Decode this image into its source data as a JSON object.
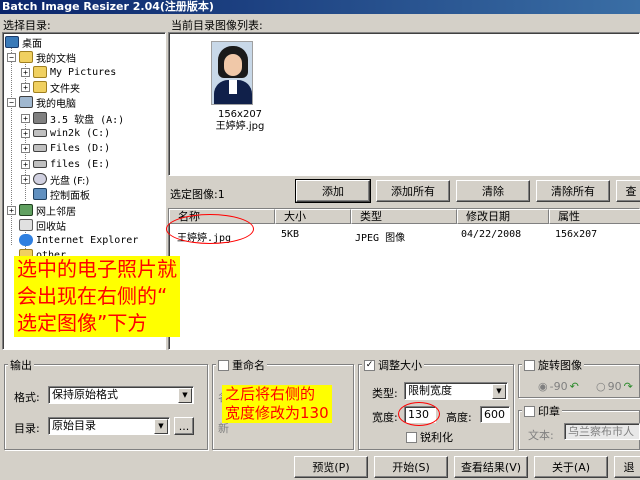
{
  "window": {
    "title": "Batch Image Resizer 2.04(注册版本)"
  },
  "tree": {
    "label": "选择目录:",
    "items": [
      {
        "label": "桌面"
      },
      {
        "label": "我的文档"
      },
      {
        "label": "My Pictures"
      },
      {
        "label": "文件夹"
      },
      {
        "label": "我的电脑"
      },
      {
        "label": "3.5 软盘 (A:)"
      },
      {
        "label": "win2k (C:)"
      },
      {
        "label": "Files (D:)"
      },
      {
        "label": "files (E:)"
      },
      {
        "label": "光盘 (F:)"
      },
      {
        "label": "控制面板"
      },
      {
        "label": "网上邻居"
      },
      {
        "label": "回收站"
      },
      {
        "label": "Internet Explorer"
      },
      {
        "label": "other"
      }
    ]
  },
  "preview": {
    "label": "当前目录图像列表:",
    "thumb_size": "156x207",
    "thumb_name": "王婷婷.jpg"
  },
  "selection": {
    "label": "选定图像:1",
    "buttons": {
      "add": "添加",
      "add_all": "添加所有",
      "clear": "清除",
      "clear_all": "清除所有",
      "view": "查"
    }
  },
  "list": {
    "columns": [
      "名称",
      "大小",
      "类型",
      "修改日期",
      "属性"
    ],
    "rows": [
      {
        "name": "王婷婷.jpg",
        "size": "5KB",
        "type": "JPEG 图像",
        "date": "04/22/2008",
        "attr": "156x207"
      }
    ]
  },
  "annotations": {
    "main": [
      "选中的电子照片就",
      "会出现在右侧的“",
      "选定图像”下方"
    ],
    "width": [
      "之后将右侧的",
      "宽度修改为130"
    ]
  },
  "output": {
    "label": "输出",
    "format_label": "格式:",
    "format_value": "保持原始格式",
    "dir_label": "目录:",
    "dir_value": "原始目录",
    "browse": "..."
  },
  "rename": {
    "label": "重命名",
    "row1": "名",
    "row2": "新"
  },
  "resize": {
    "label": "调整大小",
    "type_label": "类型:",
    "type_value": "限制宽度",
    "width_label": "宽度:",
    "width_value": "130",
    "height_label": "高度:",
    "height_value": "600",
    "sharpen_label": "锐利化"
  },
  "rotate": {
    "label": "旋转图像",
    "opt1": "-90",
    "opt2": "90"
  },
  "stamp": {
    "label": "印章",
    "text_label": "文本:",
    "text_value": "乌兰察布市人"
  },
  "actions": {
    "preview": "预览(P)",
    "start": "开始(S)",
    "results": "查看结果(V)",
    "about": "关于(A)",
    "exit": "退"
  },
  "colors": {
    "accent": "#0a246a",
    "annotation_bg": "#ffff00",
    "annotation_text": "#ff0000"
  }
}
